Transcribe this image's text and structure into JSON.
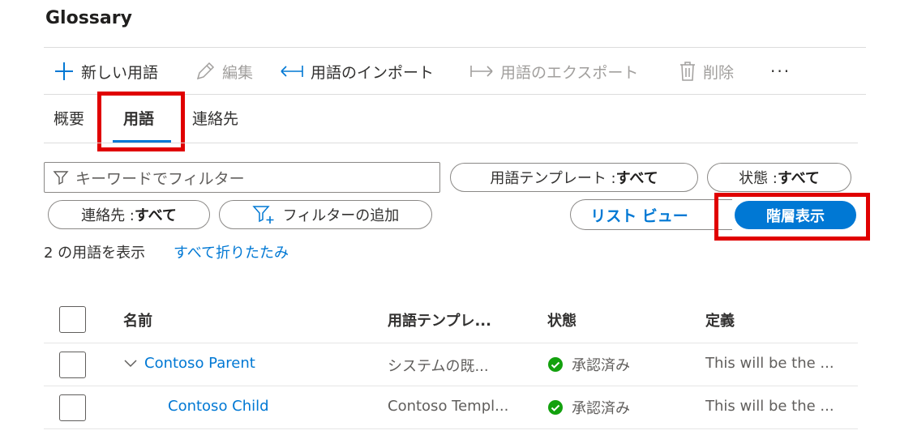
{
  "page": {
    "title": "Glossary"
  },
  "toolbar": {
    "new_term": "新しい用語",
    "edit": "編集",
    "import": "用語のインポート",
    "export": "用語のエクスポート",
    "delete": "削除",
    "more": "···"
  },
  "tabs": {
    "overview": "概要",
    "terms": "用語",
    "contacts": "連絡先"
  },
  "filters": {
    "keyword_placeholder": "キーワードでフィルター",
    "term_template_label": "用語テンプレート : ",
    "term_template_value": "すべて",
    "status_label": "状態 : ",
    "status_value": "すべて",
    "contacts_label": "連絡先 : ",
    "contacts_value": "すべて",
    "add_filter": "フィルターの追加"
  },
  "view_toggle": {
    "list_view": "リスト ビュー",
    "hierarchy_view": "階層表示"
  },
  "summary": {
    "count_text": "2 の用語を表示",
    "collapse_all": "すべて折りたたみ"
  },
  "table": {
    "headers": {
      "name": "名前",
      "template": "用語テンプレ...",
      "status": "状態",
      "definition": "定義"
    },
    "rows": [
      {
        "name": "Contoso Parent",
        "template": "システムの既...",
        "status": "承認済み",
        "definition": "This will be the ..."
      },
      {
        "name": "Contoso Child",
        "template": "Contoso Templ...",
        "status": "承認済み",
        "definition": "This will be the ..."
      }
    ]
  },
  "colors": {
    "accent": "#0078d4",
    "highlight": "#e00000",
    "approved": "#13a10e"
  }
}
